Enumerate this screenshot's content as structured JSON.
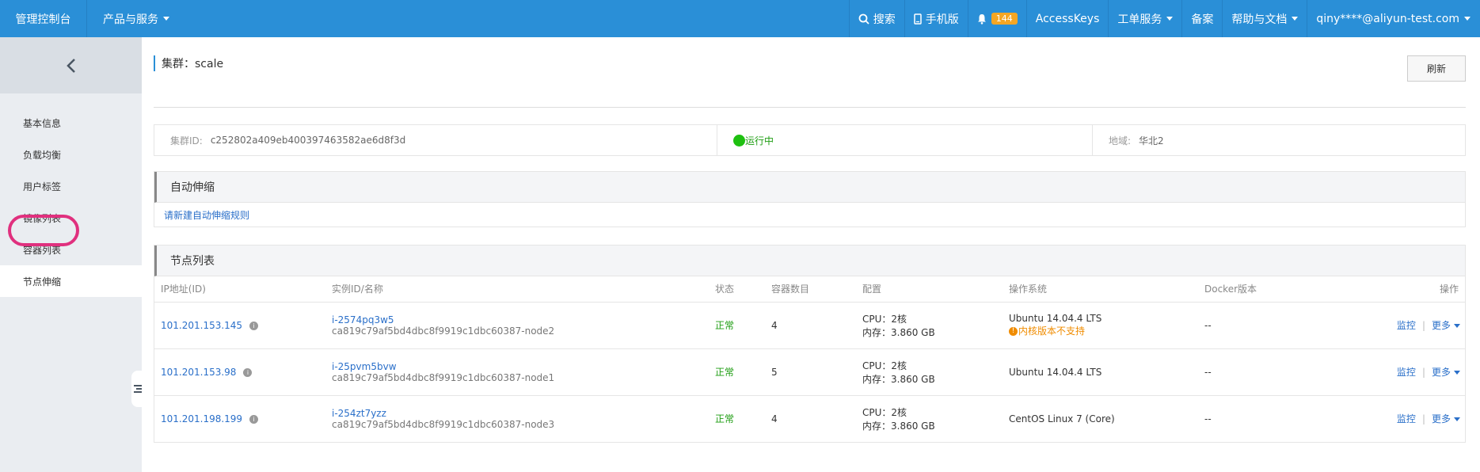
{
  "topbar": {
    "brand": "管理控制台",
    "products": "产品与服务",
    "search": "搜索",
    "mobile": "手机版",
    "notify_count": "144",
    "accesskeys": "AccessKeys",
    "tickets": "工单服务",
    "beian": "备案",
    "help": "帮助与文档",
    "user": "qiny****@aliyun-test.com"
  },
  "sidebar": {
    "items": [
      {
        "label": "基本信息"
      },
      {
        "label": "负载均衡"
      },
      {
        "label": "用户标签"
      },
      {
        "label": "镜像列表"
      },
      {
        "label": "容器列表"
      },
      {
        "label": "节点伸缩"
      }
    ]
  },
  "header": {
    "title": "集群：scale",
    "refresh": "刷新"
  },
  "cluster": {
    "id_label": "集群ID:",
    "id_value": "c252802a409eb400397463582ae6d8f3d",
    "status": "运行中",
    "region_label": "地域:",
    "region_value": "华北2"
  },
  "autoscale": {
    "title": "自动伸缩",
    "create_link": "请新建自动伸缩规则"
  },
  "nodes": {
    "title": "节点列表",
    "columns": [
      "IP地址(ID)",
      "实例ID/名称",
      "状态",
      "容器数目",
      "配置",
      "操作系统",
      "Docker版本",
      "操作"
    ],
    "rows": [
      {
        "ip": "101.201.153.145",
        "instance_id": "i-2574pq3w5",
        "instance_name": "ca819c79af5bd4dbc8f9919c1dbc60387-node2",
        "status": "正常",
        "containers": "4",
        "cpu": "CPU：2核",
        "mem": "内存：3.860 GB",
        "os": "Ubuntu 14.04.4 LTS",
        "os_warning": "内核版本不支持",
        "docker": "--",
        "op_monitor": "监控",
        "op_more": "更多"
      },
      {
        "ip": "101.201.153.98",
        "instance_id": "i-25pvm5bvw",
        "instance_name": "ca819c79af5bd4dbc8f9919c1dbc60387-node1",
        "status": "正常",
        "containers": "5",
        "cpu": "CPU：2核",
        "mem": "内存：3.860 GB",
        "os": "Ubuntu 14.04.4 LTS",
        "os_warning": "",
        "docker": "--",
        "op_monitor": "监控",
        "op_more": "更多"
      },
      {
        "ip": "101.201.198.199",
        "instance_id": "i-254zt7yzz",
        "instance_name": "ca819c79af5bd4dbc8f9919c1dbc60387-node3",
        "status": "正常",
        "containers": "4",
        "cpu": "CPU：2核",
        "mem": "内存：3.860 GB",
        "os": "CentOS Linux 7 (Core)",
        "os_warning": "",
        "docker": "--",
        "op_monitor": "监控",
        "op_more": "更多"
      }
    ]
  },
  "colors": {
    "topbar": "#2a8fd7",
    "link": "#2a6fc9",
    "ok": "#1e9d12",
    "warning": "#f08c00",
    "highlight_ring": "#e0307e"
  }
}
